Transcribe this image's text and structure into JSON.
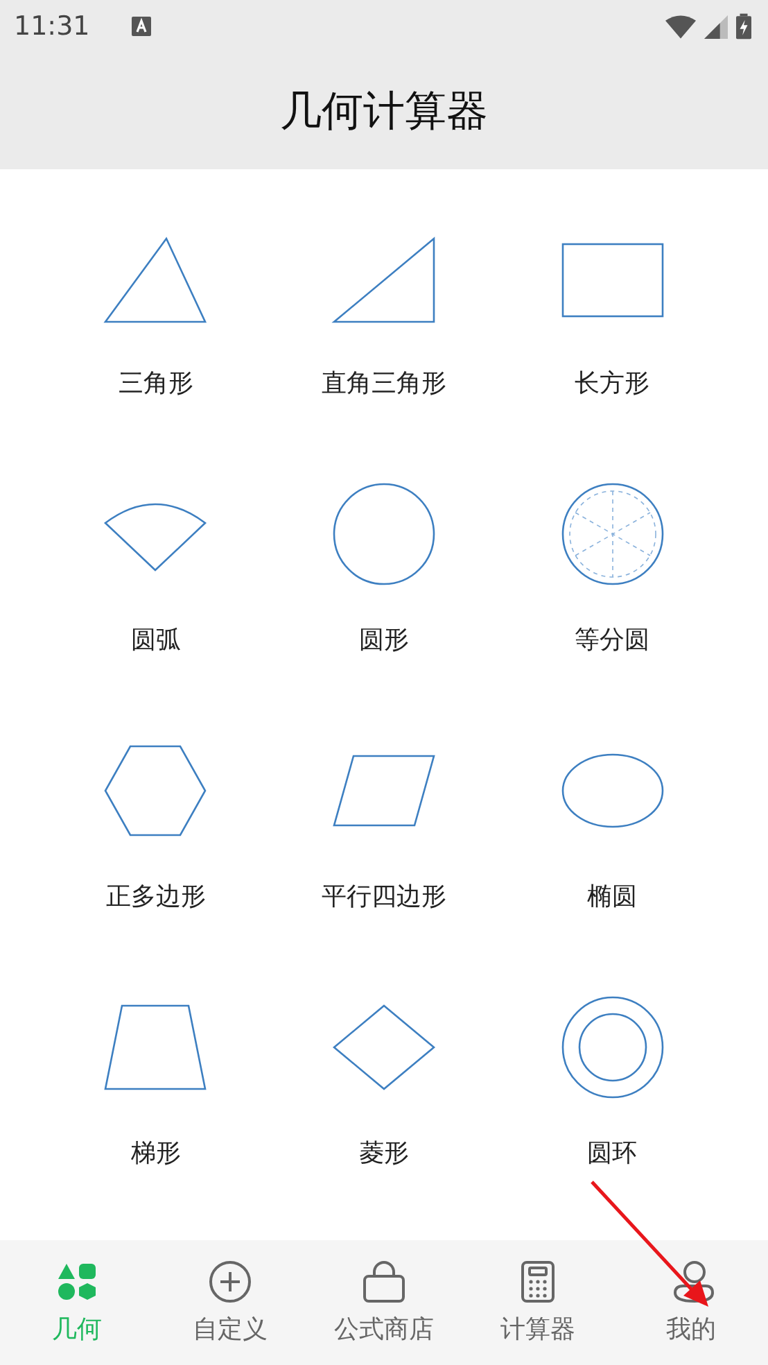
{
  "status_bar": {
    "time": "11:31"
  },
  "header": {
    "title": "几何计算器"
  },
  "shapes": [
    {
      "label": "三角形",
      "kind": "triangle"
    },
    {
      "label": "直角三角形",
      "kind": "right-triangle"
    },
    {
      "label": "长方形",
      "kind": "rectangle"
    },
    {
      "label": "圆弧",
      "kind": "sector"
    },
    {
      "label": "圆形",
      "kind": "circle"
    },
    {
      "label": "等分圆",
      "kind": "divided-circle"
    },
    {
      "label": "正多边形",
      "kind": "hexagon"
    },
    {
      "label": "平行四边形",
      "kind": "parallelogram"
    },
    {
      "label": "椭圆",
      "kind": "ellipse"
    },
    {
      "label": "梯形",
      "kind": "trapezoid"
    },
    {
      "label": "菱形",
      "kind": "rhombus"
    },
    {
      "label": "圆环",
      "kind": "ring"
    }
  ],
  "nav": [
    {
      "label": "几何",
      "kind": "shapes",
      "selected": true
    },
    {
      "label": "自定义",
      "kind": "plus",
      "selected": false
    },
    {
      "label": "公式商店",
      "kind": "bag",
      "selected": false
    },
    {
      "label": "计算器",
      "kind": "calculator",
      "selected": false
    },
    {
      "label": "我的",
      "kind": "person",
      "selected": false
    }
  ]
}
